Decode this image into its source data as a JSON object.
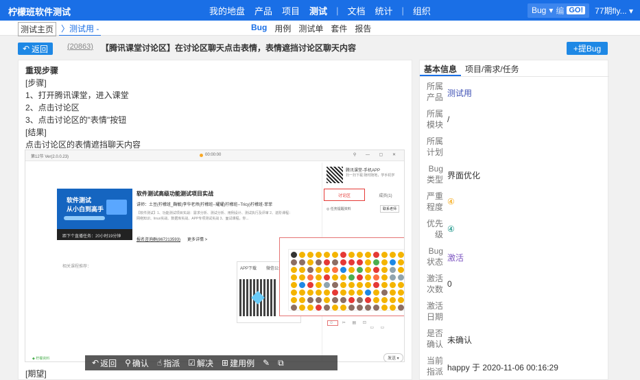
{
  "topnav": {
    "brand": "柠檬班软件测试",
    "items": [
      "我的地盘",
      "产品",
      "项目",
      "测试",
      "文档",
      "统计",
      "组织"
    ],
    "active": "测试",
    "bug_search_label": "Bug",
    "bug_search_placeholder": "编",
    "go_label": "GO!",
    "user": "77期fly..."
  },
  "subnav": {
    "crumb_home": "测试主页",
    "crumb_current": "测试用",
    "items": [
      "Bug",
      "用例",
      "测试单",
      "套件",
      "报告"
    ],
    "active": "Bug"
  },
  "header": {
    "back_label": "返回",
    "bug_id": "20863",
    "title": "【腾讯课堂讨论区】在讨论区聊天点击表情，表情遮挡讨论区聊天内容",
    "add_bug_label": "+提Bug"
  },
  "steps": {
    "section_title": "重现步骤",
    "lines": [
      "[步骤]",
      "1、打开腾讯课堂，进入课堂",
      "2、点击讨论区",
      "3、点击讨论区的\"表情\"按钮",
      "[结果]",
      "点击讨论区的表情遮挡聊天内容"
    ],
    "expect": "[期望]"
  },
  "screenshot": {
    "version": "第12节 Ver(2.0.0.23)",
    "time": "00:00:00",
    "card_line1": "软件测试",
    "card_line2": "从小白到高手",
    "card_bar": "距下个直播任务：20小时19分钟",
    "course_title": "软件测试高级功能测试项目实战",
    "course_sub": "讲师：土豆(柠檬班_鞠敏)李华老师(柠檬班--耀耀)柠檬班--Tricy)柠檬班-菲菲",
    "course_desc": "【软件测试】1、功能测试项目实战：需求分析、测试分析、用例设计、测试执行及评审 2、进阶课程：网络知识、linux实战、数据库实战、APP专项测试实战 3、面试课程，你...",
    "course_link": "报名咨询群(867213593)",
    "course_more": "更多详情 >",
    "recommend": "相关课程推荐：",
    "app_tab1": "APP下载",
    "app_tab2": "微信公众号",
    "side_title": "腾讯课堂-手机APP",
    "side_sub": "扫一扫下载 随时随地，学手机学",
    "discuss_tab": "讨论区",
    "member_tab": "成员(1)",
    "notice": "◎ 任务提醒资料",
    "contact": "联系老师",
    "send": "发送 ▾",
    "green_link": "◆ 柠檬资料",
    "emoji_colors": [
      "#333",
      "#f4b400",
      "#f4b400",
      "#f4b400",
      "#f4b400",
      "#f4b400",
      "#e53935",
      "#f4b400",
      "#f4b400",
      "#f4b400",
      "#e53935",
      "#f4b400",
      "#f4b400",
      "#f4b400",
      "#8d6e63",
      "#8d6e63",
      "#f4b400",
      "#8d6e63",
      "#e53935",
      "#8d6e63",
      "#e53935",
      "#e53935",
      "#e53935",
      "#f4b400",
      "#4caf50",
      "#f4b400",
      "#1e88e5",
      "#f4b400",
      "#f4b400",
      "#f4b400",
      "#8d6e63",
      "#f4b400",
      "#f4b400",
      "#ff7043",
      "#1e88e5",
      "#f4b400",
      "#4caf50",
      "#f4b400",
      "#e53935",
      "#f4b400",
      "#90a4ae",
      "#f4b400",
      "#f4b400",
      "#f4b400",
      "#ff7043",
      "#f4b400",
      "#e53935",
      "#f4b400",
      "#f4b400",
      "#4caf50",
      "#e53935",
      "#f4b400",
      "#ff7043",
      "#f4b400",
      "#90a4ae",
      "#90a4ae",
      "#f4b400",
      "#1e88e5",
      "#e53935",
      "#f4b400",
      "#90a4ae",
      "#8d6e63",
      "#f4b400",
      "#f4b400",
      "#f4b400",
      "#f4b400",
      "#e53935",
      "#f4b400",
      "#f4b400",
      "#f4b400",
      "#f4b400",
      "#f4b400",
      "#f4b400",
      "#f4b400",
      "#f4b400",
      "#e53935",
      "#f4b400",
      "#f4b400",
      "#f4b400",
      "#1e88e5",
      "#f4b400",
      "#8d6e63",
      "#f4b400",
      "#f4b400",
      "#f4b400",
      "#f4b400",
      "#8d6e63",
      "#8d6e63",
      "#f4b400",
      "#8d6e63",
      "#8d6e63",
      "#e53935",
      "#8d6e63",
      "#e53935",
      "#f4b400",
      "#f4b400",
      "#f4b400",
      "#f4b400",
      "#8d6e63",
      "#f4b400",
      "#f4b400",
      "#e53935",
      "#8d6e63",
      "#f4b400",
      "#f4b400",
      "#8d6e63",
      "#8d6e63",
      "#8d6e63",
      "#8d6e63",
      "#f4b400",
      "#f4b400",
      "#8d6e63"
    ]
  },
  "floatbar": {
    "back": "返回",
    "confirm": "确认",
    "assign": "指派",
    "resolve": "解决",
    "create_case": "建用例"
  },
  "rightpanel": {
    "tabs": [
      "基本信息",
      "项目/需求/任务"
    ],
    "active_tab": "基本信息",
    "props": [
      {
        "key": "所属产品",
        "value": "测试用",
        "style": "link"
      },
      {
        "key": "所属模块",
        "value": "/",
        "style": ""
      },
      {
        "key": "所属计划",
        "value": "",
        "style": ""
      },
      {
        "key": "Bug类型",
        "value": "界面优化",
        "style": ""
      },
      {
        "key": "严重程度",
        "value": "④",
        "style": "orange"
      },
      {
        "key": "优先级",
        "value": "④",
        "style": "teal"
      },
      {
        "key": "Bug状态",
        "value": "激活",
        "style": "purple"
      },
      {
        "key": "激活次数",
        "value": "0",
        "style": ""
      },
      {
        "key": "激活日期",
        "value": "",
        "style": ""
      },
      {
        "key": "是否确认",
        "value": "未确认",
        "style": ""
      },
      {
        "key": "当前指派",
        "value": "happy 于 2020-11-06 00:16:29",
        "style": ""
      }
    ]
  },
  "colors": {
    "brand_blue": "#1a6fe6",
    "button_blue": "#1e88e5",
    "highlight_red": "#e53935"
  }
}
